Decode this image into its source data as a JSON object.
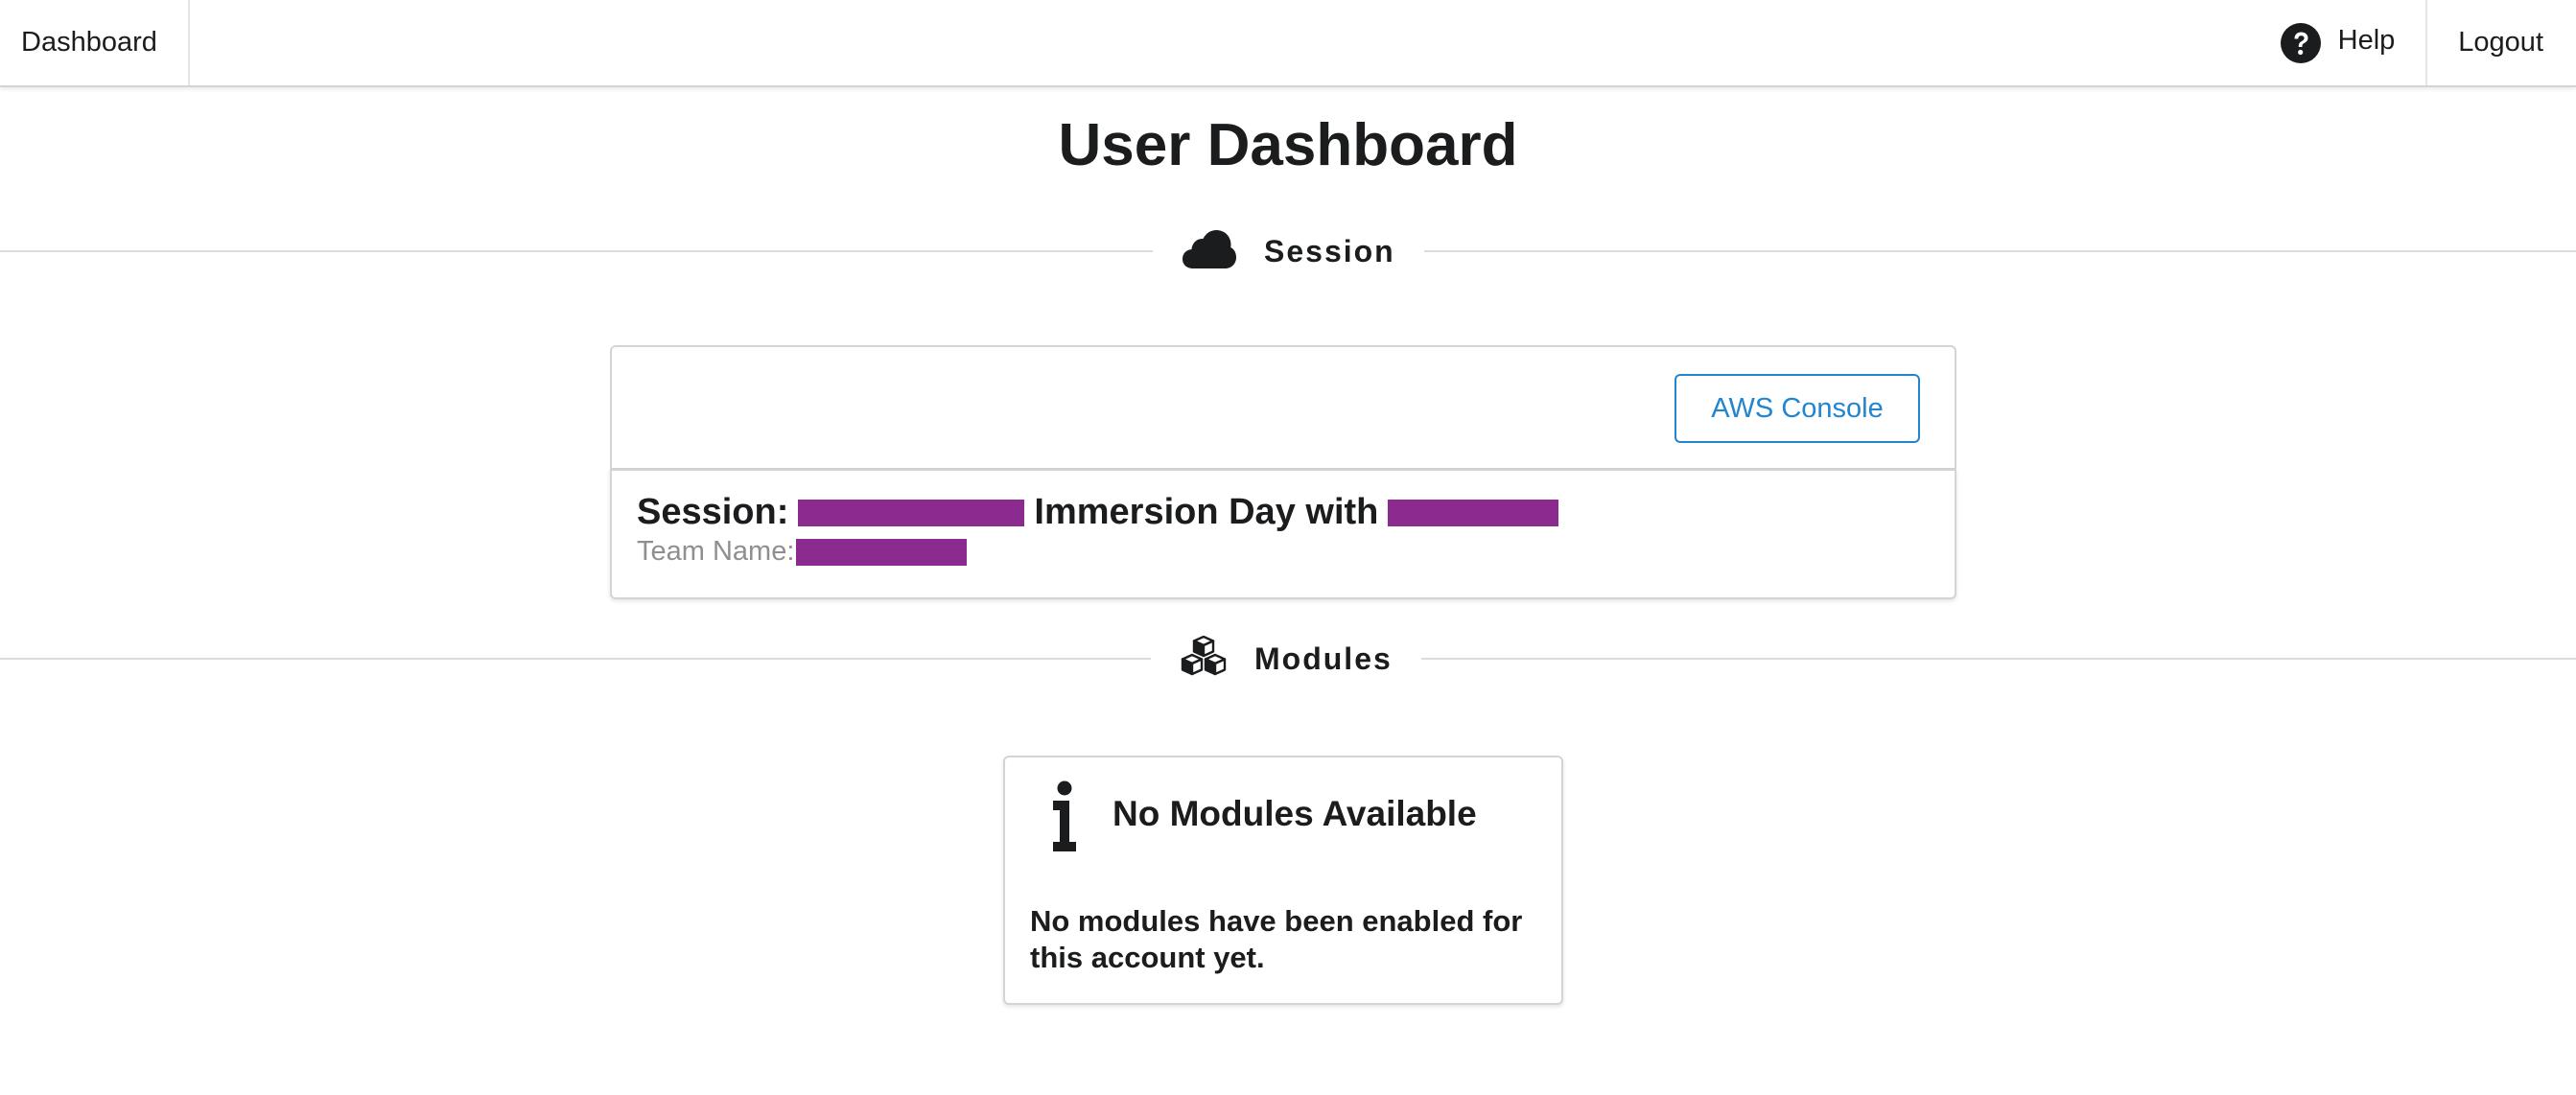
{
  "menu": {
    "dashboard_label": "Dashboard",
    "help_label": "Help",
    "logout_label": "Logout"
  },
  "page": {
    "title": "User Dashboard"
  },
  "sections": {
    "session_label": "Session",
    "modules_label": "Modules"
  },
  "session": {
    "console_button_label": "AWS Console",
    "session_prefix": "Session:",
    "session_middle": "Immersion Day with",
    "team_label": "Team Name:",
    "redaction_color": "#8b2a8f"
  },
  "modules": {
    "empty_title": "No Modules Available",
    "empty_message": "No modules have been enabled for this account yet."
  },
  "colors": {
    "accent_blue": "#2185d0",
    "text": "#1b1c1d",
    "muted_text": "#8f8f8f"
  },
  "icons": {
    "help": "question-circle",
    "session": "cloud",
    "modules": "cubes",
    "empty_state": "info"
  }
}
